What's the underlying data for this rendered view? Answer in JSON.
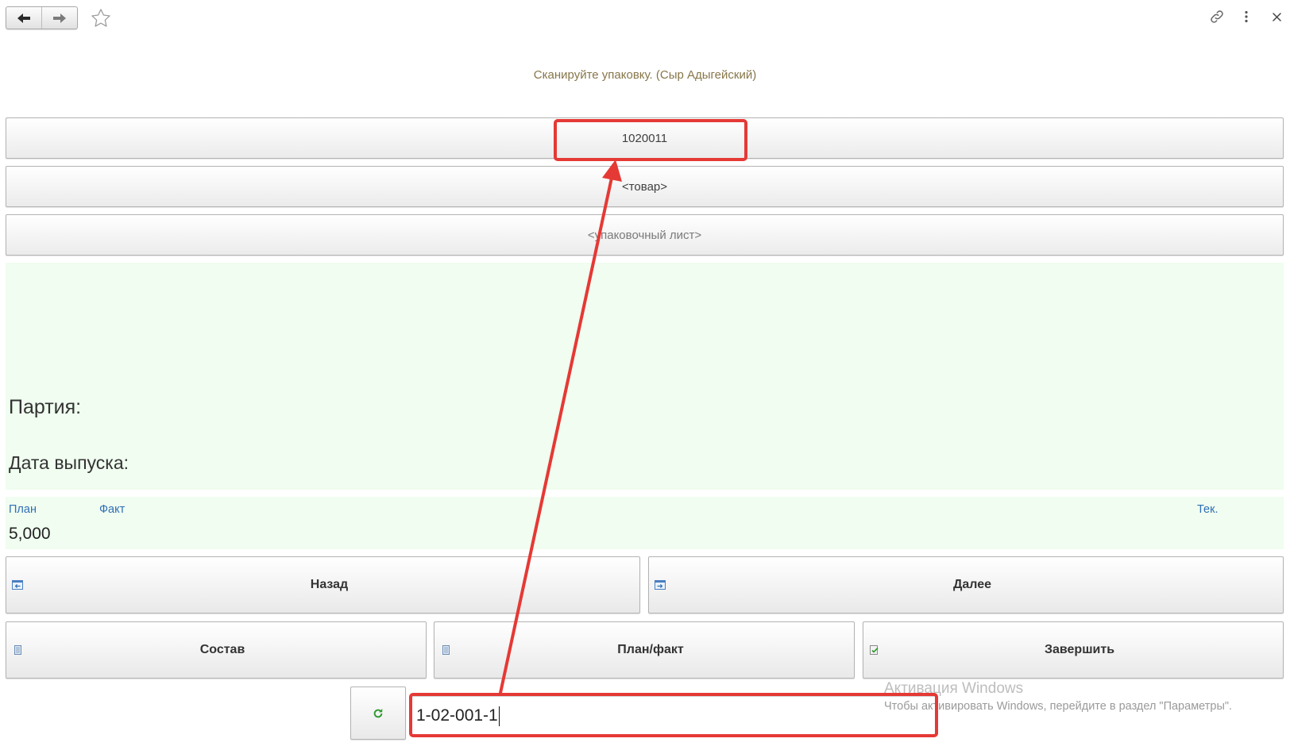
{
  "header": {
    "instruction": "Сканируйте упаковку. (Сыр Адыгейский)"
  },
  "fields": {
    "barcode": "1020011",
    "product": "<товар>",
    "packing_list": "<упаковочный лист>"
  },
  "batch": {
    "batch_label": "Партия:",
    "release_date_label": "Дата выпуска:"
  },
  "quantities": {
    "plan_label": "План",
    "fact_label": "Факт",
    "current_label": "Тек.",
    "plan_value": "5,000"
  },
  "buttons": {
    "back": "Назад",
    "next": "Далее",
    "composition": "Состав",
    "plan_fact": "План/факт",
    "finish": "Завершить"
  },
  "scan_input": {
    "value": "1-02-001-1"
  },
  "watermark": {
    "title": "Активация Windows",
    "text": "Чтобы активировать Windows, перейдите в раздел \"Параметры\"."
  },
  "icons": {
    "nav_back": "arrow-left-icon",
    "nav_forward": "arrow-right-icon",
    "favorite": "star-icon",
    "link": "link-icon",
    "more": "kebab-menu-icon",
    "close": "close-icon",
    "back_button": "window-arrow-left-icon",
    "next_button": "window-arrow-right-icon",
    "composition_button": "document-icon",
    "plan_fact_button": "document-icon",
    "finish_button": "document-check-icon",
    "refresh": "refresh-icon"
  },
  "colors": {
    "instruction_text": "#867649",
    "panel_green": "#f0fdf0",
    "label_blue": "#2f6fb5",
    "refresh_green": "#2f9a2f",
    "annotation_red": "#e53935"
  }
}
